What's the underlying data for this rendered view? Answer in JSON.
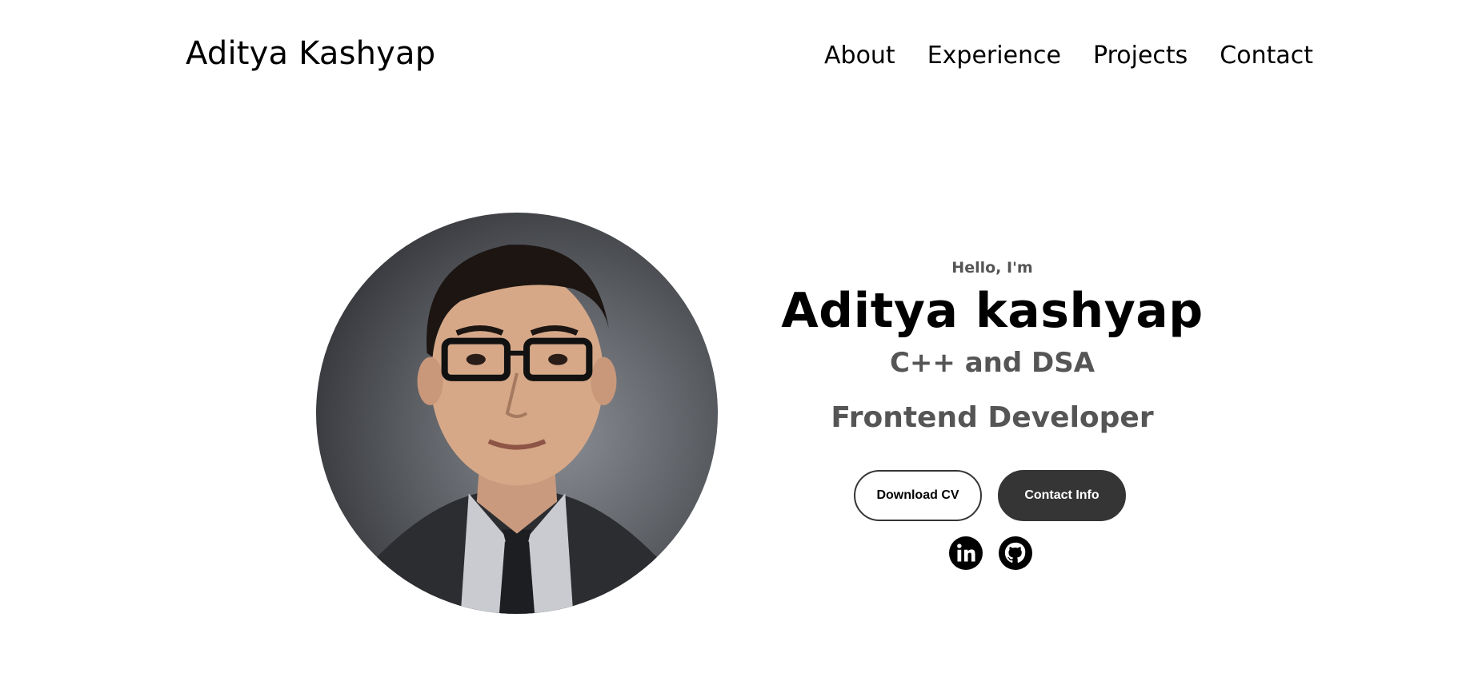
{
  "header": {
    "logo": "Aditya Kashyap",
    "nav": [
      "About",
      "Experience",
      "Projects",
      "Contact"
    ]
  },
  "hero": {
    "greeting": "Hello, I'm",
    "name": "Aditya kashyap",
    "role_primary": "C++ and DSA",
    "role_secondary": "Frontend Developer",
    "buttons": {
      "download_cv": "Download CV",
      "contact_info": "Contact Info"
    },
    "socials": [
      {
        "icon": "linkedin-icon"
      },
      {
        "icon": "github-icon"
      }
    ]
  },
  "colors": {
    "text_primary": "#000000",
    "text_secondary": "#555555",
    "button_dark": "#353535",
    "background": "#ffffff"
  }
}
